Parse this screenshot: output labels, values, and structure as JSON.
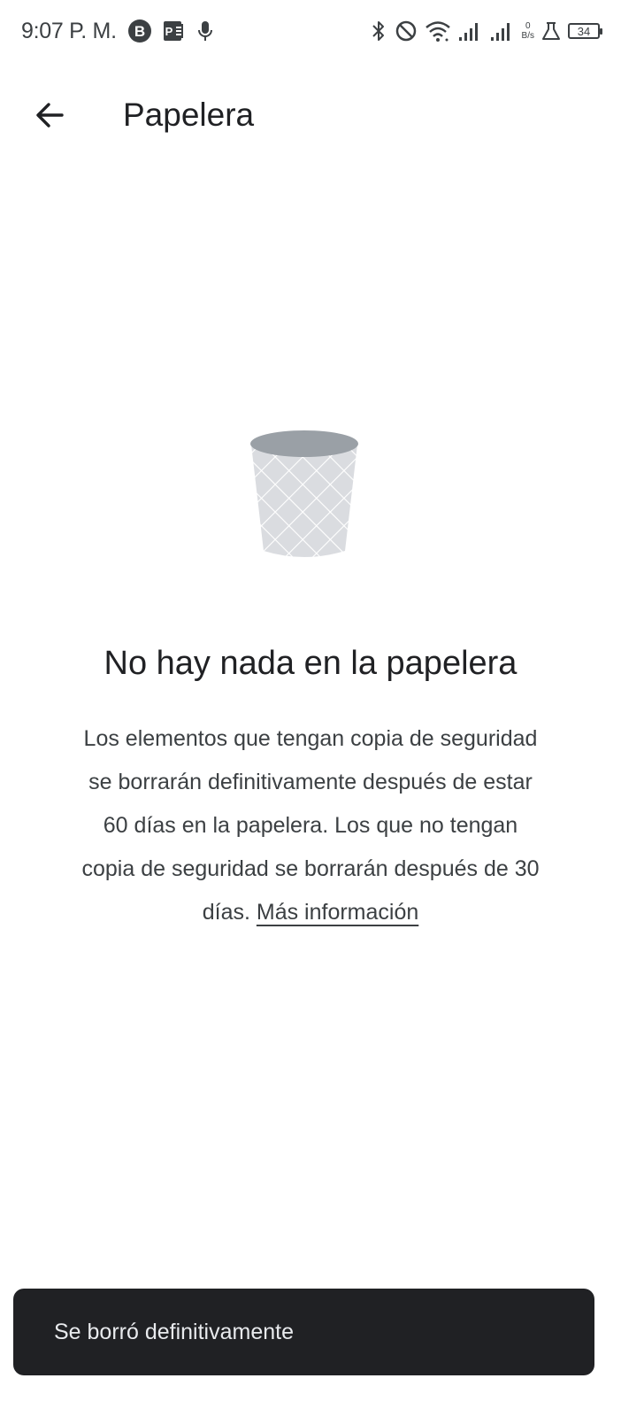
{
  "status_bar": {
    "time": "9:07 P. M.",
    "left_icons": [
      "b-badge-icon",
      "document-app-icon",
      "microphone-icon"
    ],
    "right_icons": [
      "bluetooth-icon",
      "do-not-disturb-icon",
      "wifi-icon",
      "signal-icon",
      "signal-icon-2",
      "lab-icon"
    ],
    "net_speed_value": "0",
    "net_speed_unit": "B/s",
    "battery": "34"
  },
  "app_bar": {
    "back_icon": "arrow-back-icon",
    "title": "Papelera"
  },
  "empty_state": {
    "illustration": "trash-can-icon",
    "title": "No hay nada en la papelera",
    "description": "Los elementos que tengan copia de seguridad se borrarán definitivamente después de estar 60 días en la papelera. Los que no tengan copia de seguridad se borrarán después de 30 días.",
    "learn_more": "Más información"
  },
  "snackbar": {
    "message": "Se borró definitivamente"
  },
  "colors": {
    "background": "#ffffff",
    "text_primary": "#202124",
    "text_secondary": "#3c4043",
    "snackbar_bg": "#202124",
    "snackbar_text": "#e8eaed",
    "trash_lid": "#9aa0a6",
    "trash_body": "#dadce0"
  }
}
